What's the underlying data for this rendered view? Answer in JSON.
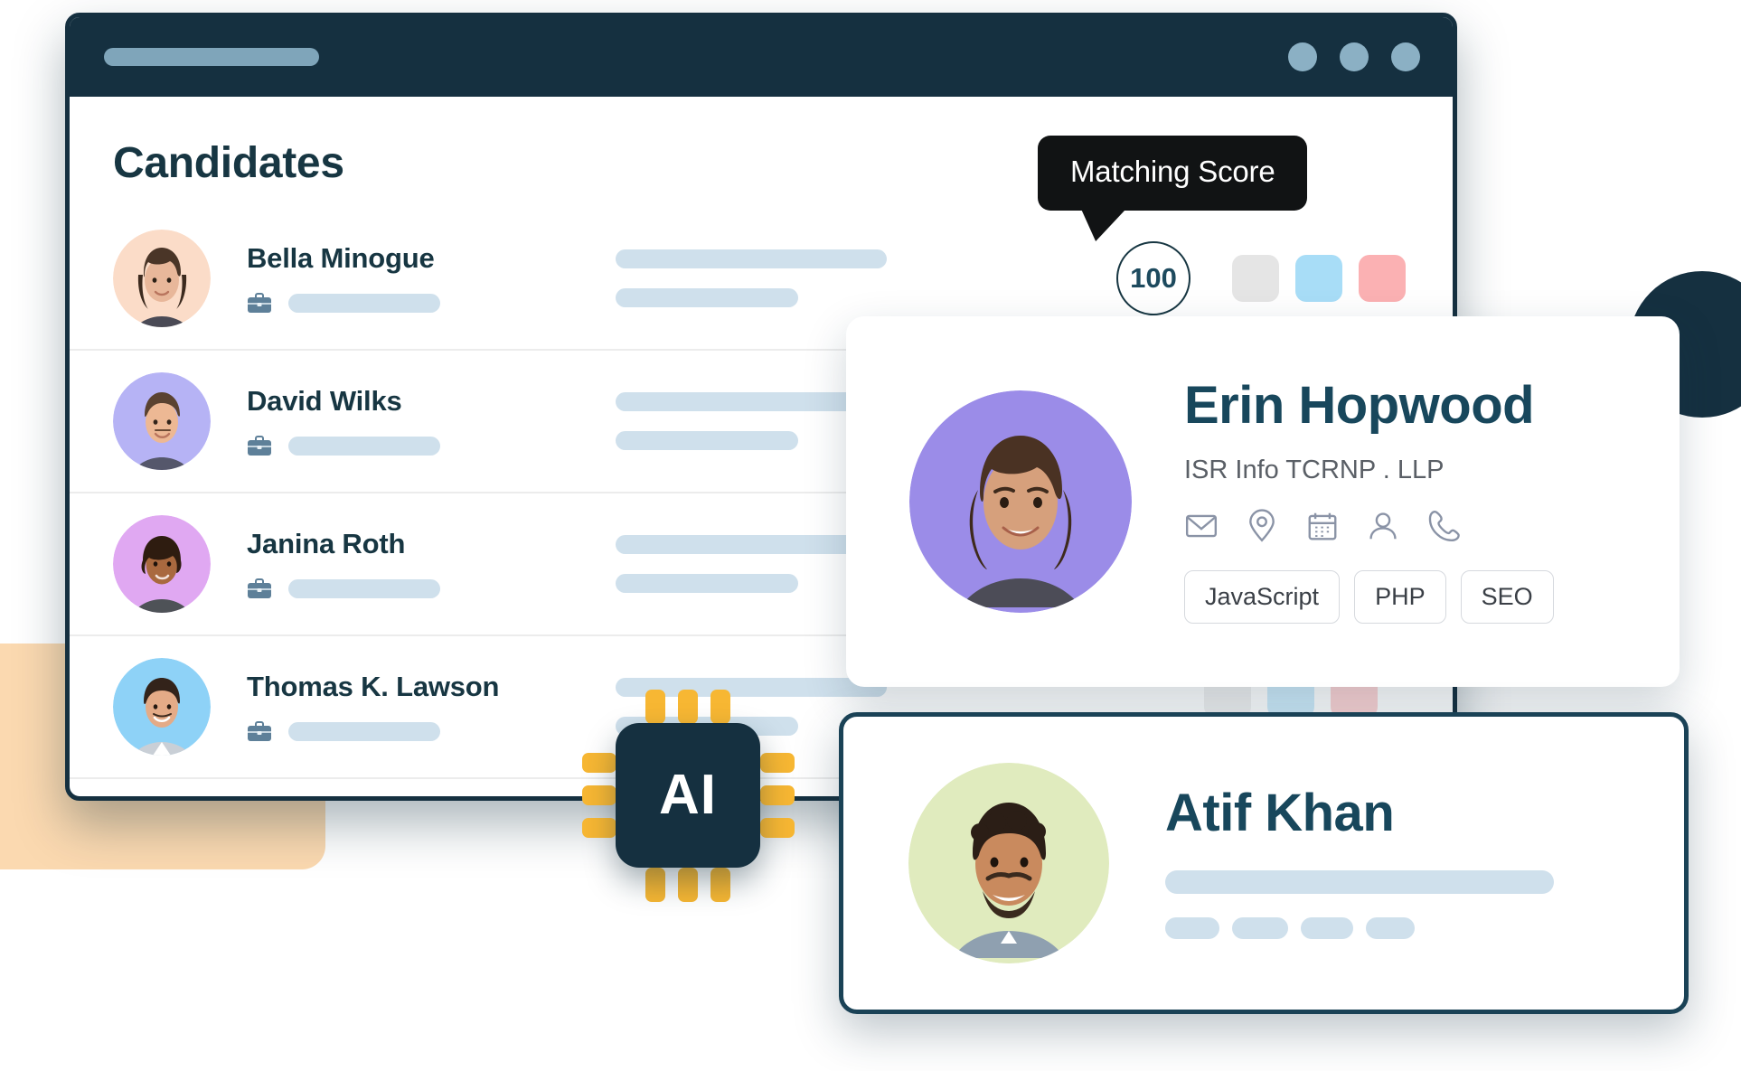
{
  "browser": {
    "url_placeholder_bar": "",
    "window_dots": [
      "minimize-dot",
      "maximize-dot",
      "close-dot"
    ]
  },
  "page": {
    "title": "Candidates"
  },
  "tooltip": {
    "label": "Matching Score"
  },
  "score": {
    "value": "100"
  },
  "swatch_colors": [
    "#E5E5E5",
    "#A8DDF7",
    "#FBB1B3"
  ],
  "chip": {
    "label": "AI"
  },
  "colors": {
    "brand_dark": "#153040",
    "text_dark": "#173642",
    "accent_yellow": "#F7B733",
    "skeleton": "#CFE0EC",
    "peach": "#FBD9B0"
  },
  "candidates": [
    {
      "name": "Bella Minogue",
      "avatar_bg": "#FBDCC8",
      "job_icon": "briefcase-icon"
    },
    {
      "name": "David Wilks",
      "avatar_bg": "#B6B3F5",
      "job_icon": "briefcase-icon"
    },
    {
      "name": "Janina Roth",
      "avatar_bg": "#E0A8F2",
      "job_icon": "briefcase-icon"
    },
    {
      "name": "Thomas K. Lawson",
      "avatar_bg": "#8ED2F7",
      "job_icon": "briefcase-icon"
    }
  ],
  "profile_cards": [
    {
      "name": "Erin Hopwood",
      "company": "ISR Info TCRNP . LLP",
      "avatar_bg": "#9B8CE8",
      "contact_icons": [
        "email-icon",
        "location-icon",
        "calendar-icon",
        "person-icon",
        "phone-icon"
      ],
      "tags": [
        "JavaScript",
        "PHP",
        "SEO"
      ]
    },
    {
      "name": "Atif Khan",
      "avatar_bg": "#E0EBBE"
    }
  ]
}
